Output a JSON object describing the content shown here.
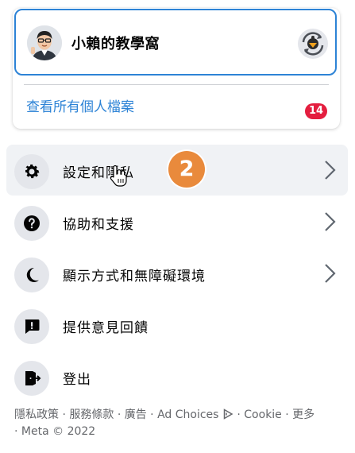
{
  "profile": {
    "name": "小賴的教學窩",
    "avatar_icon": "user-avatar-icon",
    "switch_icon": "switch-profile-icon"
  },
  "view_all": {
    "label": "查看所有個人檔案",
    "badge_count": "14"
  },
  "menu": [
    {
      "label": "設定和隱私",
      "icon": "gear-icon",
      "has_chevron": true
    },
    {
      "label": "協助和支援",
      "icon": "question-icon",
      "has_chevron": true
    },
    {
      "label": "顯示方式和無障礙環境",
      "icon": "moon-icon",
      "has_chevron": true
    },
    {
      "label": "提供意見回饋",
      "icon": "feedback-icon",
      "has_chevron": false
    },
    {
      "label": "登出",
      "icon": "logout-icon",
      "has_chevron": false
    }
  ],
  "step_badge": "2",
  "footer": {
    "privacy": "隱私政策",
    "terms": "服務條款",
    "ads": "廣告",
    "ad_choices": "Ad Choices",
    "cookie": "Cookie",
    "more": "更多",
    "copyright": "Meta © 2022",
    "sep": "·"
  },
  "colors": {
    "accent": "#2d83d6",
    "badge_red": "#e41e3f",
    "step_orange": "#e98a3c"
  }
}
